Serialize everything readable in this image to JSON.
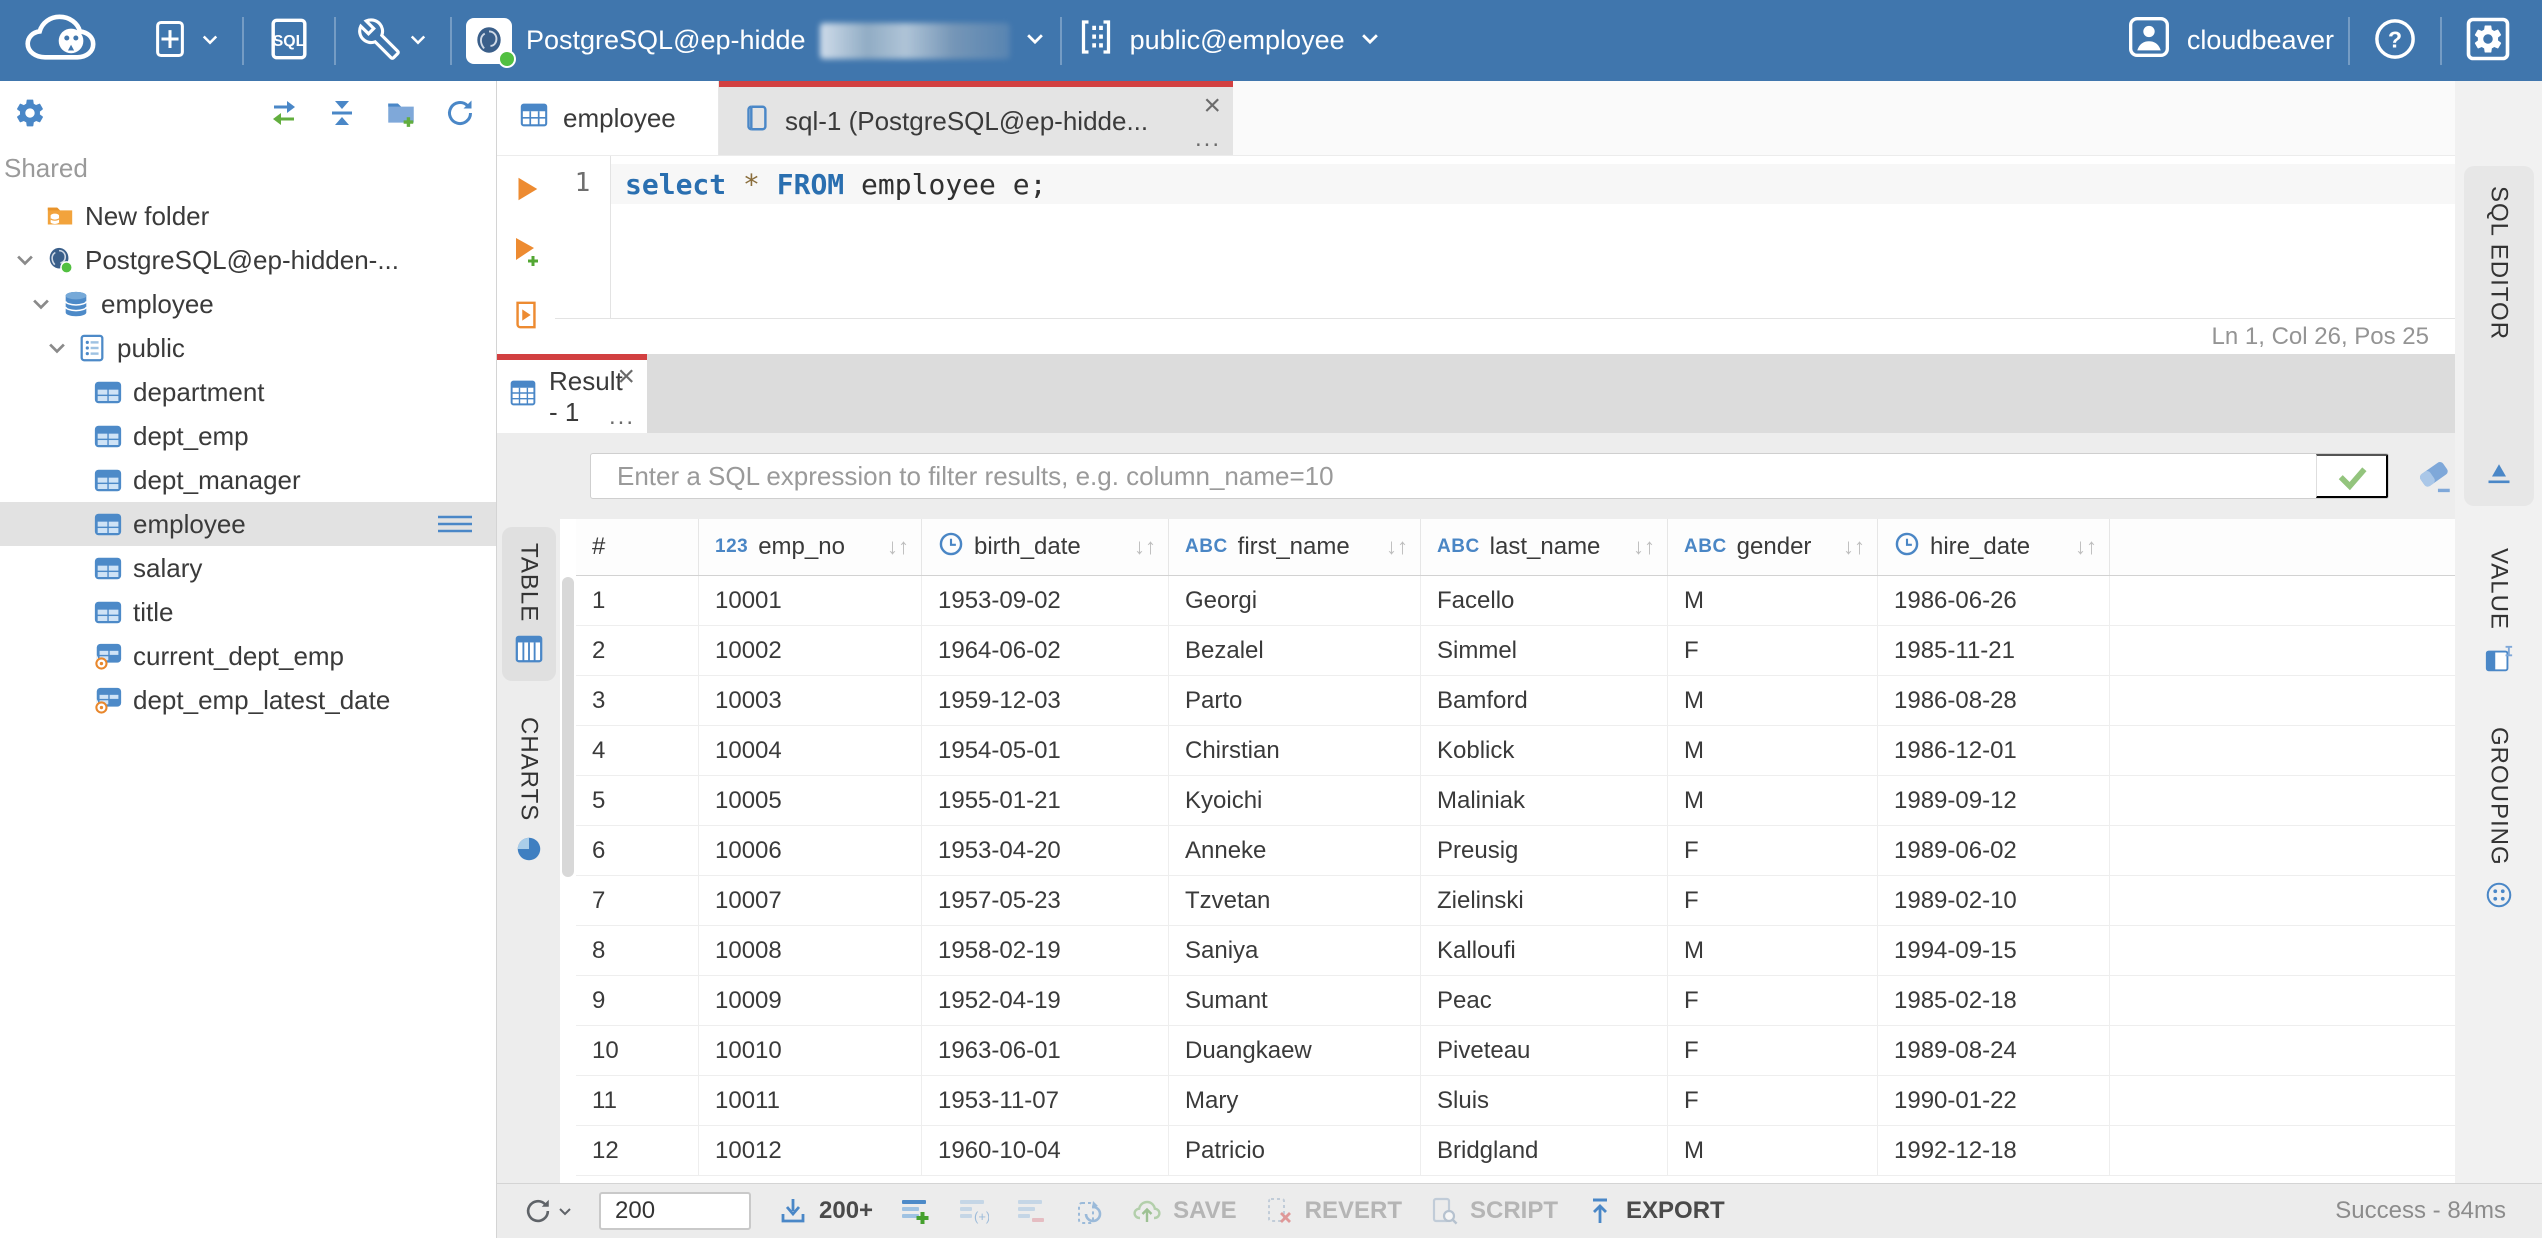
{
  "header": {
    "connection": {
      "name": "PostgreSQL@ep-hidde",
      "redacted": true
    },
    "schema_selector": {
      "name": "public@employee"
    },
    "user_name": "cloudbeaver",
    "sql_button_label": "SQL"
  },
  "sidebar": {
    "section_label": "Shared",
    "tree": [
      {
        "label": "New folder",
        "depth": 1,
        "icon": "folder-db",
        "expandable": false,
        "selected": false
      },
      {
        "label": "PostgreSQL@ep-hidden-...",
        "depth": 1,
        "icon": "postgres",
        "expandable": true,
        "selected": false
      },
      {
        "label": "employee",
        "depth": 2,
        "icon": "database",
        "expandable": true,
        "selected": false
      },
      {
        "label": "public",
        "depth": 3,
        "icon": "schema",
        "expandable": true,
        "selected": false
      },
      {
        "label": "department",
        "depth": 4,
        "icon": "table",
        "expandable": false,
        "selected": false
      },
      {
        "label": "dept_emp",
        "depth": 4,
        "icon": "table",
        "expandable": false,
        "selected": false
      },
      {
        "label": "dept_manager",
        "depth": 4,
        "icon": "table",
        "expandable": false,
        "selected": false
      },
      {
        "label": "employee",
        "depth": 4,
        "icon": "table",
        "expandable": false,
        "selected": true
      },
      {
        "label": "salary",
        "depth": 4,
        "icon": "table",
        "expandable": false,
        "selected": false
      },
      {
        "label": "title",
        "depth": 4,
        "icon": "table",
        "expandable": false,
        "selected": false
      },
      {
        "label": "current_dept_emp",
        "depth": 4,
        "icon": "view",
        "expandable": false,
        "selected": false
      },
      {
        "label": "dept_emp_latest_date",
        "depth": 4,
        "icon": "view",
        "expandable": false,
        "selected": false
      }
    ]
  },
  "editor_tabs": [
    {
      "label": "employee",
      "active": false
    },
    {
      "label": "sql-1 (PostgreSQL@ep-hidde...",
      "active": true
    }
  ],
  "sql_editor": {
    "line_number": "1",
    "tokens": [
      {
        "text": "select",
        "type": "keyword"
      },
      {
        "text": " ",
        "type": "plain"
      },
      {
        "text": "*",
        "type": "operator"
      },
      {
        "text": " ",
        "type": "plain"
      },
      {
        "text": "FROM",
        "type": "keyword"
      },
      {
        "text": " employee e;",
        "type": "plain"
      }
    ],
    "status": "Ln 1, Col 26, Pos 25"
  },
  "result": {
    "tab_label": "Result - 1",
    "filter_placeholder": "Enter a SQL expression to filter results, e.g. column_name=10",
    "left_tabs": [
      {
        "label": "TABLE"
      },
      {
        "label": "CHARTS"
      }
    ],
    "right_tabs": [
      {
        "label": "SQL EDITOR"
      },
      {
        "label": "VALUE"
      },
      {
        "label": "GROUPING"
      }
    ],
    "table": {
      "columns": [
        {
          "label": "#",
          "type": "rownum"
        },
        {
          "label": "emp_no",
          "type": "number"
        },
        {
          "label": "birth_date",
          "type": "date"
        },
        {
          "label": "first_name",
          "type": "string"
        },
        {
          "label": "last_name",
          "type": "string"
        },
        {
          "label": "gender",
          "type": "string"
        },
        {
          "label": "hire_date",
          "type": "date"
        }
      ],
      "rows": [
        [
          "1",
          "10001",
          "1953-09-02",
          "Georgi",
          "Facello",
          "M",
          "1986-06-26"
        ],
        [
          "2",
          "10002",
          "1964-06-02",
          "Bezalel",
          "Simmel",
          "F",
          "1985-11-21"
        ],
        [
          "3",
          "10003",
          "1959-12-03",
          "Parto",
          "Bamford",
          "M",
          "1986-08-28"
        ],
        [
          "4",
          "10004",
          "1954-05-01",
          "Chirstian",
          "Koblick",
          "M",
          "1986-12-01"
        ],
        [
          "5",
          "10005",
          "1955-01-21",
          "Kyoichi",
          "Maliniak",
          "M",
          "1989-09-12"
        ],
        [
          "6",
          "10006",
          "1953-04-20",
          "Anneke",
          "Preusig",
          "F",
          "1989-06-02"
        ],
        [
          "7",
          "10007",
          "1957-05-23",
          "Tzvetan",
          "Zielinski",
          "F",
          "1989-02-10"
        ],
        [
          "8",
          "10008",
          "1958-02-19",
          "Saniya",
          "Kalloufi",
          "M",
          "1994-09-15"
        ],
        [
          "9",
          "10009",
          "1952-04-19",
          "Sumant",
          "Peac",
          "F",
          "1985-02-18"
        ],
        [
          "10",
          "10010",
          "1963-06-01",
          "Duangkaew",
          "Piveteau",
          "F",
          "1989-08-24"
        ],
        [
          "11",
          "10011",
          "1953-11-07",
          "Mary",
          "Sluis",
          "F",
          "1990-01-22"
        ],
        [
          "12",
          "10012",
          "1960-10-04",
          "Patricio",
          "Bridgland",
          "M",
          "1992-12-18"
        ]
      ]
    }
  },
  "toolbar": {
    "row_limit": "200",
    "fetch_more_label": "200+",
    "save_label": "SAVE",
    "revert_label": "REVERT",
    "script_label": "SCRIPT",
    "export_label": "EXPORT",
    "status": "Success - 84ms"
  },
  "colors": {
    "header_blue": "#4076ad",
    "accent_red": "#d24041",
    "icon_blue": "#4a87c7",
    "green": "#52c041",
    "orange": "#ed8b31"
  }
}
